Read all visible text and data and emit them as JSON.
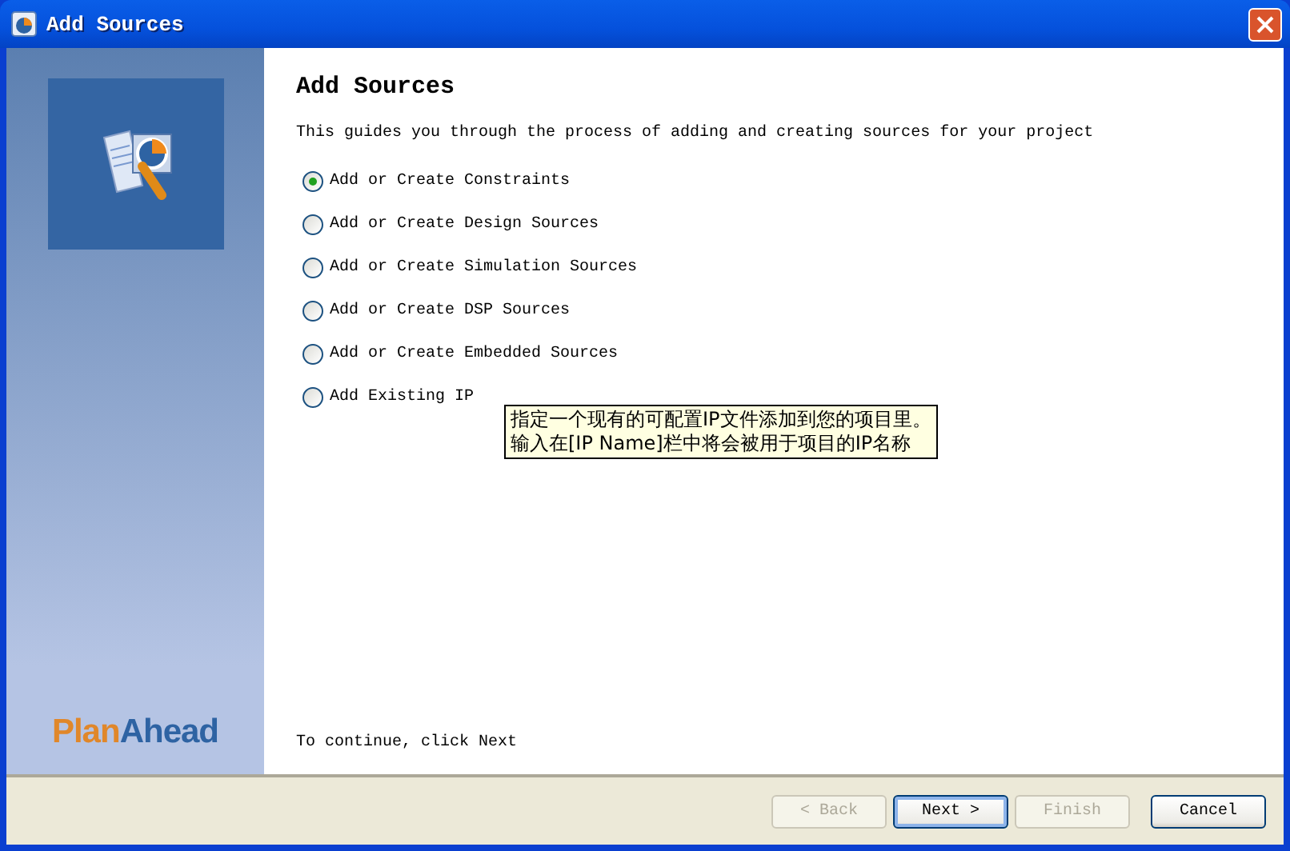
{
  "window": {
    "title": "Add Sources"
  },
  "sidebar": {
    "logo_parts": [
      "Plan",
      "Ahead"
    ]
  },
  "page": {
    "heading": "Add Sources",
    "description": "This guides you through the process of adding and creating sources for your project",
    "options": [
      {
        "label": "Add or Create Constraints",
        "selected": true
      },
      {
        "label": "Add or Create Design Sources",
        "selected": false
      },
      {
        "label": "Add or Create Simulation Sources",
        "selected": false
      },
      {
        "label": "Add or Create DSP Sources",
        "selected": false
      },
      {
        "label": "Add or Create Embedded Sources",
        "selected": false
      },
      {
        "label": "Add Existing IP",
        "selected": false
      }
    ],
    "tooltip": [
      "指定一个现有的可配置IP文件添加到您的项目里。",
      "输入在[IP Name]栏中将会被用于项目的IP名称"
    ],
    "footer_hint": "To continue, click Next"
  },
  "buttons": [
    {
      "label": "< Back",
      "disabled": true,
      "default": false
    },
    {
      "label": "Next >",
      "disabled": false,
      "default": true
    },
    {
      "label": "Finish",
      "disabled": true,
      "default": false
    },
    {
      "label": "Cancel",
      "disabled": false,
      "default": false
    }
  ]
}
